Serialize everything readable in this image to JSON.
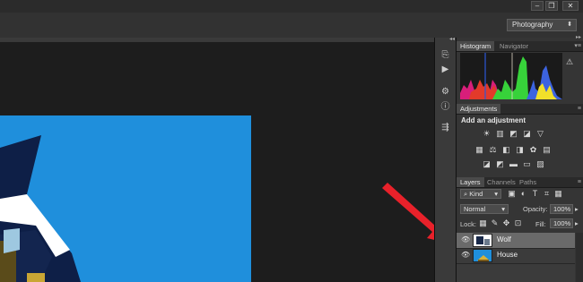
{
  "workspace": {
    "selected": "Photography"
  },
  "window_controls": {
    "minimize": "–",
    "restore": "❐",
    "close": "✕"
  },
  "panel_tabs_top": [
    "Histogram",
    "Navigator"
  ],
  "adjustments": {
    "tab": "Adjustments",
    "title": "Add an adjustment",
    "icons_row1": [
      "brightness-icon",
      "levels-icon",
      "curves-icon",
      "exposure-icon",
      "gradient-triangle-icon"
    ],
    "icons_row2": [
      "vibrance-icon",
      "hue-saturation-icon",
      "color-balance-icon",
      "black-white-icon",
      "photo-filter-icon",
      "channel-mixer-icon",
      "color-lookup-icon"
    ],
    "icons_row3": [
      "invert-icon",
      "posterize-icon",
      "threshold-icon",
      "gradient-map-icon",
      "selective-color-icon"
    ]
  },
  "layers_panel": {
    "tabs": [
      "Layers",
      "Channels",
      "Paths"
    ],
    "kind_label": "Kind",
    "blend_mode": "Normal",
    "opacity_label": "Opacity:",
    "opacity_value": "100%",
    "lock_label": "Lock:",
    "fill_label": "Fill:",
    "fill_value": "100%",
    "layers": [
      {
        "name": "Wolf",
        "selected": true
      },
      {
        "name": "House",
        "selected": false
      }
    ]
  },
  "colors": {
    "sky": "#1f8fdc",
    "arrow": "#e8212a",
    "panel_bg": "#353535",
    "app_bg": "#1c1c1c"
  }
}
